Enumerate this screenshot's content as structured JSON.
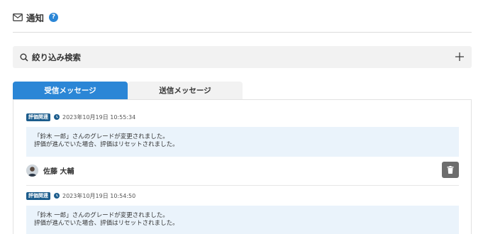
{
  "header": {
    "title": "通知",
    "help_glyph": "?"
  },
  "search": {
    "label": "絞り込み検索"
  },
  "tabs": [
    {
      "label": "受信メッセージ",
      "active": true
    },
    {
      "label": "送信メッセージ",
      "active": false
    }
  ],
  "messages": [
    {
      "tag": "評価関連",
      "timestamp": "2023年10月19日 10:55:34",
      "lines": [
        "「鈴木 一郎」さんのグレードが変更されました。",
        "評価が進んでいた場合、評価はリセットされました。"
      ],
      "sender": "佐藤 大輔"
    },
    {
      "tag": "評価関連",
      "timestamp": "2023年10月19日 10:54:50",
      "lines": [
        "「鈴木 一郎」さんのグレードが変更されました。",
        "評価が進んでいた場合、評価はリセットされました。"
      ]
    }
  ],
  "colors": {
    "accent": "#2b86d6",
    "tag": "#1b5c8c",
    "message_bg": "#eaf3fb",
    "trash": "#6d6d6d"
  }
}
